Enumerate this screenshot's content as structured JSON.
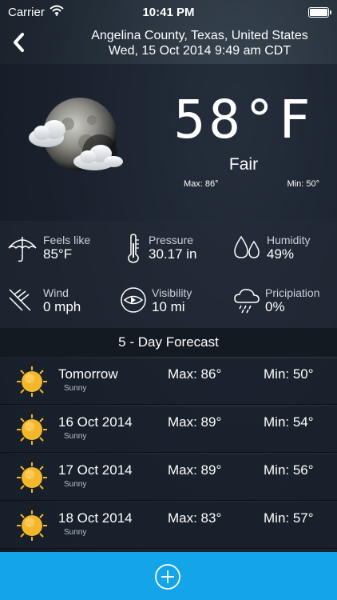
{
  "status_bar": {
    "carrier": "Carrier",
    "time": "10:41 PM",
    "battery_level": 1.0
  },
  "header": {
    "location": "Angelina County, Texas, United States",
    "datetime": "Wed, 15 Oct 2014 9:49 am CDT"
  },
  "current": {
    "temperature": "58°F",
    "condition": "Fair",
    "max": "Max: 86°",
    "min": "Min: 50°",
    "icon": "moon-cloud-icon"
  },
  "details": [
    {
      "label": "Feels like",
      "value": "85°F",
      "icon": "umbrella-icon"
    },
    {
      "label": "Pressure",
      "value": "30.17 in",
      "icon": "thermometer-icon"
    },
    {
      "label": "Humidity",
      "value": "49%",
      "icon": "droplets-icon"
    },
    {
      "label": "Wind",
      "value": "0 mph",
      "icon": "wind-icon"
    },
    {
      "label": "Visibility",
      "value": "10 mi",
      "icon": "eye-icon"
    },
    {
      "label": "Pricipiation",
      "value": "0%",
      "icon": "rain-cloud-icon"
    }
  ],
  "forecast": {
    "title": "5 - Day Forecast",
    "days": [
      {
        "day": "Tomorrow",
        "condition": "Sunny",
        "max": "Max: 86°",
        "min": "Min: 50°"
      },
      {
        "day": "16 Oct 2014",
        "condition": "Sunny",
        "max": "Max: 89°",
        "min": "Min: 54°"
      },
      {
        "day": "17 Oct 2014",
        "condition": "Sunny",
        "max": "Max: 89°",
        "min": "Min: 56°"
      },
      {
        "day": "18 Oct 2014",
        "condition": "Sunny",
        "max": "Max: 83°",
        "min": "Min: 57°"
      }
    ]
  },
  "colors": {
    "accent": "#14a4e8",
    "sun": "#f5b62b"
  }
}
